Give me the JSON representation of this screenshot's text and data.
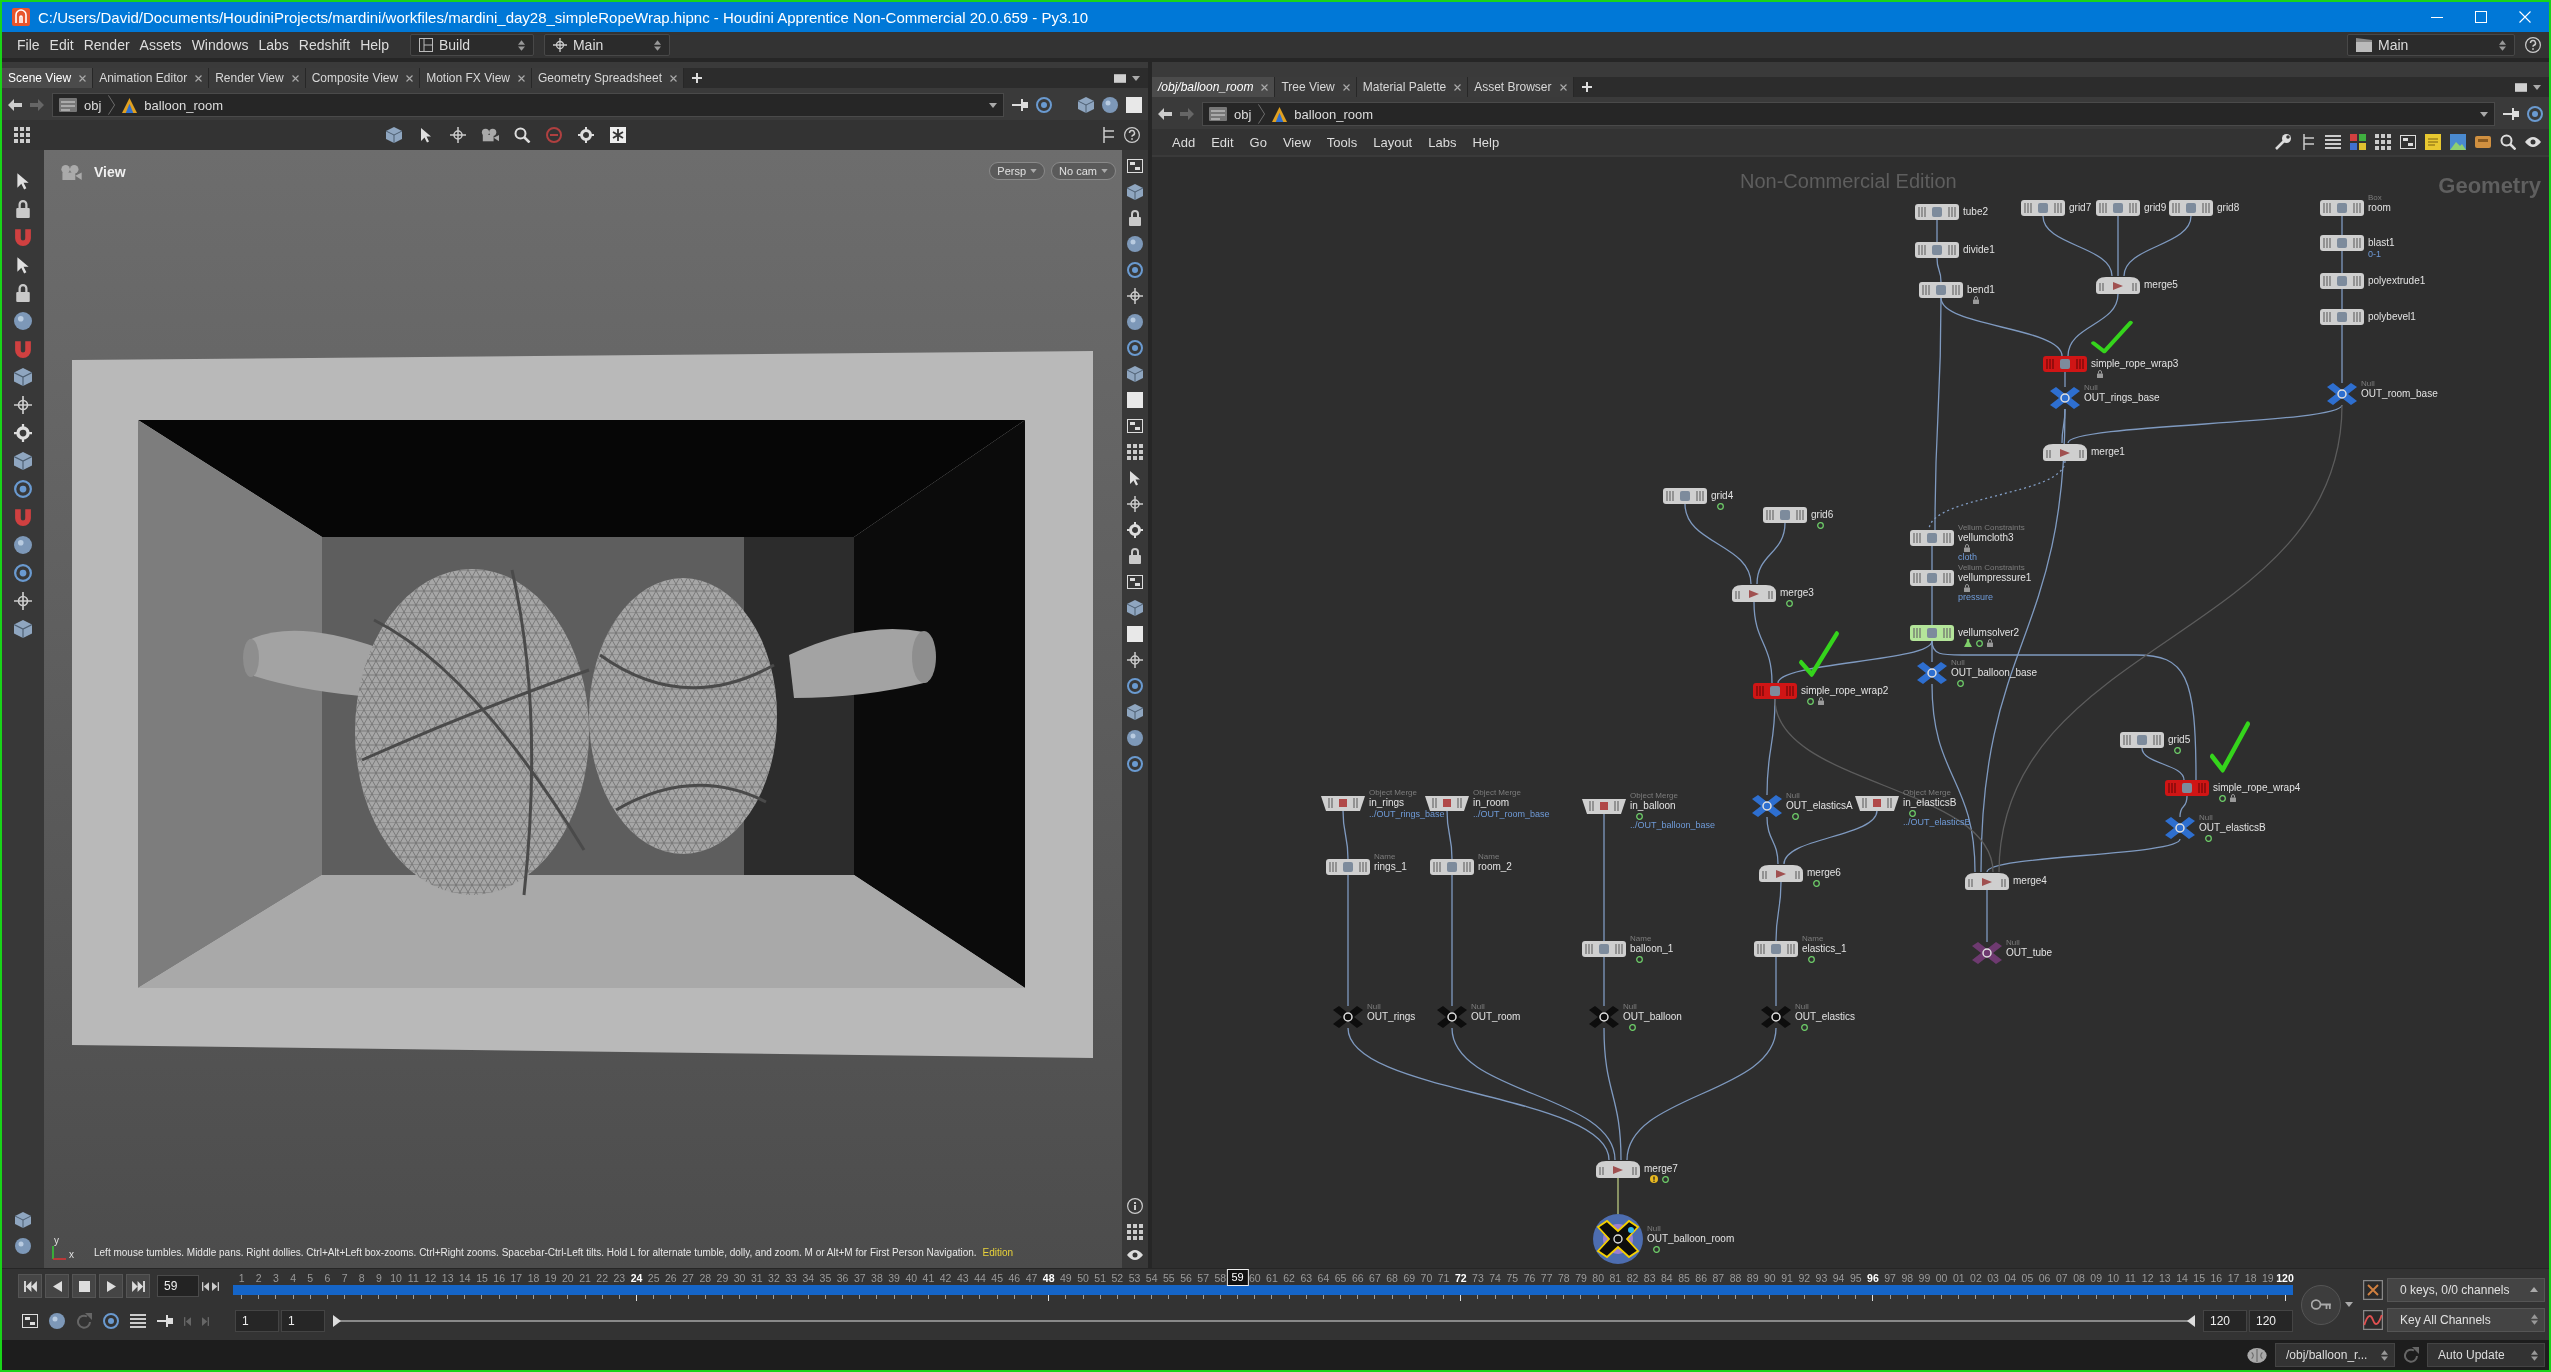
{
  "window": {
    "title": "C:/Users/David/Documents/HoudiniProjects/mardini/workfiles/mardini_day28_simpleRopeWrap.hipnc - Houdini Apprentice Non-Commercial 20.0.659 - Py3.10"
  },
  "menu": [
    "File",
    "Edit",
    "Render",
    "Assets",
    "Windows",
    "Labs",
    "Redshift",
    "Help"
  ],
  "shelf_set": "Build",
  "desktop": "Main",
  "right_desktop": "Main",
  "left_pane": {
    "tabs": [
      {
        "label": "Scene View",
        "selected": true
      },
      {
        "label": "Animation Editor",
        "selected": false
      },
      {
        "label": "Render View",
        "selected": false
      },
      {
        "label": "Composite View",
        "selected": false
      },
      {
        "label": "Motion FX View",
        "selected": false
      },
      {
        "label": "Geometry Spreadsheet",
        "selected": false
      }
    ],
    "path": [
      "obj",
      "balloon_room"
    ],
    "viewport": {
      "title": "View",
      "camera_buttons": [
        "Persp",
        "No cam"
      ],
      "axis_labels": [
        "y",
        "x"
      ],
      "hint": "Left mouse tumbles. Middle pans. Right dollies. Ctrl+Alt+Left box-zooms. Ctrl+Right zooms. Spacebar-Ctrl-Left tilts. Hold L for alternate tumble, dolly, and zoom. M or Alt+M for First Person Navigation.",
      "edition": "Edition"
    }
  },
  "right_pane": {
    "tabs": [
      {
        "label": "/obj/balloon_room",
        "selected": true
      },
      {
        "label": "Tree View",
        "selected": false
      },
      {
        "label": "Material Palette",
        "selected": false
      },
      {
        "label": "Asset Browser",
        "selected": false
      }
    ],
    "path": [
      "obj",
      "balloon_room"
    ],
    "menu": [
      "Add",
      "Edit",
      "Go",
      "View",
      "Tools",
      "Layout",
      "Labs",
      "Help"
    ],
    "watermark": "Non-Commercial Edition",
    "context": "Geometry",
    "nodes": [
      {
        "name": "tube2",
        "kind": "sop",
        "color": "#cfcfcf",
        "display": false
      },
      {
        "name": "grid7",
        "kind": "sop",
        "color": "#cfcfcf",
        "display": false
      },
      {
        "name": "grid9",
        "kind": "sop",
        "color": "#cfcfcf",
        "display": false
      },
      {
        "name": "grid8",
        "kind": "sop",
        "color": "#cfcfcf",
        "display": false
      },
      {
        "name": "room",
        "type": "Box",
        "kind": "sop",
        "color": "#cfcfcf",
        "display": false
      },
      {
        "name": "divide1",
        "kind": "sop",
        "color": "#cfcfcf",
        "display": false
      },
      {
        "name": "blast1",
        "parameter": "0-1",
        "kind": "sop",
        "color": "#cfcfcf",
        "display": false
      },
      {
        "name": "bend1",
        "badges": [
          {
            "kind": "lock"
          }
        ],
        "kind": "sop",
        "color": "#cfcfcf",
        "display": false
      },
      {
        "name": "merge5",
        "kind": "merge",
        "color": "#cfcfcf",
        "display": false
      },
      {
        "name": "polyextrude1",
        "kind": "sop",
        "color": "#cfcfcf",
        "display": false
      },
      {
        "name": "polybevel1",
        "kind": "sop",
        "color": "#cfcfcf",
        "display": false
      },
      {
        "name": "simple_rope_wrap3",
        "badges": [
          {
            "kind": "lock"
          }
        ],
        "kind": "sop",
        "color": "#d01515",
        "display": false
      },
      {
        "name": "OUT_rings_base",
        "type": "Null",
        "kind": "null",
        "color": "#2e6fd0",
        "display": false
      },
      {
        "name": "OUT_room_base",
        "type": "Null",
        "kind": "null",
        "color": "#2e6fd0",
        "display": false
      },
      {
        "name": "merge1",
        "kind": "merge",
        "color": "#cfcfcf",
        "display": false
      },
      {
        "name": "grid4",
        "badges": [
          {
            "kind": "dot"
          }
        ],
        "kind": "sop",
        "color": "#cfcfcf",
        "display": false
      },
      {
        "name": "grid6",
        "badges": [
          {
            "kind": "dot"
          }
        ],
        "kind": "sop",
        "color": "#cfcfcf",
        "display": false
      },
      {
        "name": "vellumcloth3",
        "type": "Vellum Constraints",
        "badges": [
          {
            "kind": "lock"
          }
        ],
        "parameter": "cloth",
        "kind": "sop",
        "color": "#cfcfcf",
        "display": false
      },
      {
        "name": "merge3",
        "badges": [
          {
            "kind": "dot"
          }
        ],
        "kind": "merge",
        "color": "#cfcfcf",
        "display": false
      },
      {
        "name": "vellumpressure1",
        "type": "Vellum Constraints",
        "badges": [
          {
            "kind": "lock"
          }
        ],
        "parameter": "pressure",
        "kind": "sop",
        "color": "#cfcfcf",
        "display": false
      },
      {
        "name": "vellumsolver2",
        "badges": [
          {
            "kind": "flask"
          },
          {
            "kind": "dot"
          },
          {
            "kind": "lock"
          }
        ],
        "kind": "sop",
        "color": "#b4e59a",
        "display": false
      },
      {
        "name": "OUT_balloon_base",
        "type": "Null",
        "badges": [
          {
            "kind": "dot"
          }
        ],
        "kind": "null",
        "color": "#2e6fd0",
        "display": false
      },
      {
        "name": "simple_rope_wrap2",
        "badges": [
          {
            "kind": "dot"
          },
          {
            "kind": "lock"
          }
        ],
        "kind": "sop",
        "color": "#d01515",
        "display": false
      },
      {
        "name": "grid5",
        "badges": [
          {
            "kind": "dot"
          }
        ],
        "kind": "sop",
        "color": "#cfcfcf",
        "display": false
      },
      {
        "name": "simple_rope_wrap4",
        "badges": [
          {
            "kind": "dot"
          },
          {
            "kind": "lock"
          }
        ],
        "kind": "sop",
        "color": "#d01515",
        "display": false
      },
      {
        "name": "in_rings",
        "type": "Object Merge",
        "parameter": "../OUT_rings_base",
        "kind": "objectmerge",
        "color": "#cfcfcf",
        "display": false
      },
      {
        "name": "in_room",
        "type": "Object Merge",
        "parameter": "../OUT_room_base",
        "kind": "objectmerge",
        "color": "#cfcfcf",
        "display": false
      },
      {
        "name": "in_balloon",
        "type": "Object Merge",
        "badges": [
          {
            "kind": "dot"
          }
        ],
        "parameter": "../OUT_balloon_base",
        "kind": "objectmerge",
        "color": "#cfcfcf",
        "display": false
      },
      {
        "name": "OUT_elasticsA",
        "type": "Null",
        "badges": [
          {
            "kind": "dot"
          }
        ],
        "kind": "null",
        "color": "#2e6fd0",
        "display": false
      },
      {
        "name": "in_elasticsB",
        "type": "Object Merge",
        "badges": [
          {
            "kind": "dot"
          }
        ],
        "parameter": "../OUT_elasticsB",
        "kind": "objectmerge",
        "color": "#cfcfcf",
        "display": false
      },
      {
        "name": "OUT_elasticsB",
        "type": "Null",
        "badges": [
          {
            "kind": "dot"
          }
        ],
        "kind": "null",
        "color": "#2e6fd0",
        "display": false
      },
      {
        "name": "rings_1",
        "type": "Name",
        "kind": "sop",
        "color": "#cfcfcf",
        "display": false
      },
      {
        "name": "room_2",
        "type": "Name",
        "kind": "sop",
        "color": "#cfcfcf",
        "display": false
      },
      {
        "name": "merge6",
        "badges": [
          {
            "kind": "dot"
          }
        ],
        "kind": "merge",
        "color": "#cfcfcf",
        "display": false
      },
      {
        "name": "merge4",
        "kind": "merge",
        "color": "#cfcfcf",
        "display": false
      },
      {
        "name": "balloon_1",
        "type": "Name",
        "badges": [
          {
            "kind": "dot"
          }
        ],
        "kind": "sop",
        "color": "#cfcfcf",
        "display": false
      },
      {
        "name": "elastics_1",
        "type": "Name",
        "badges": [
          {
            "kind": "dot"
          }
        ],
        "kind": "sop",
        "color": "#cfcfcf",
        "display": false
      },
      {
        "name": "OUT_tube",
        "type": "Null",
        "kind": "null",
        "color": "#6e3a70",
        "display": false
      },
      {
        "name": "OUT_rings",
        "type": "Null",
        "kind": "null",
        "color": "#0d0d0d",
        "display": false
      },
      {
        "name": "OUT_room",
        "type": "Null",
        "kind": "null",
        "color": "#0d0d0d",
        "display": false
      },
      {
        "name": "OUT_balloon",
        "type": "Null",
        "badges": [
          {
            "kind": "dot"
          }
        ],
        "kind": "null",
        "color": "#0d0d0d",
        "display": false
      },
      {
        "name": "OUT_elastics",
        "type": "Null",
        "badges": [
          {
            "kind": "dot"
          }
        ],
        "kind": "null",
        "color": "#0d0d0d",
        "display": false
      },
      {
        "name": "merge7",
        "badges": [
          {
            "kind": "warning"
          },
          {
            "kind": "dot"
          }
        ],
        "kind": "merge",
        "color": "#cfcfcf",
        "display": false
      },
      {
        "name": "OUT_balloon_room",
        "type": "Null",
        "badges": [
          {
            "kind": "dot"
          }
        ],
        "kind": "null",
        "color": "#0d0d0d",
        "display": true
      }
    ]
  },
  "timeline": {
    "frame": "59",
    "frames_before": [
      {
        "label": "1",
        "major": false
      },
      {
        "label": "2",
        "major": false
      },
      {
        "label": "3",
        "major": false
      },
      {
        "label": "4",
        "major": false
      },
      {
        "label": "5",
        "major": false
      },
      {
        "label": "6",
        "major": false
      },
      {
        "label": "7",
        "major": false
      },
      {
        "label": "8",
        "major": false
      },
      {
        "label": "9",
        "major": false
      },
      {
        "label": "10",
        "major": false
      },
      {
        "label": "11",
        "major": false
      },
      {
        "label": "12",
        "major": false
      },
      {
        "label": "13",
        "major": false
      },
      {
        "label": "14",
        "major": false
      },
      {
        "label": "15",
        "major": false
      },
      {
        "label": "16",
        "major": false
      },
      {
        "label": "17",
        "major": false
      },
      {
        "label": "18",
        "major": false
      },
      {
        "label": "19",
        "major": false
      },
      {
        "label": "20",
        "major": false
      },
      {
        "label": "21",
        "major": false
      },
      {
        "label": "22",
        "major": false
      },
      {
        "label": "23",
        "major": false
      },
      {
        "label": "24",
        "major": true
      },
      {
        "label": "25",
        "major": false
      },
      {
        "label": "26",
        "major": false
      },
      {
        "label": "27",
        "major": false
      },
      {
        "label": "28",
        "major": false
      },
      {
        "label": "29",
        "major": false
      },
      {
        "label": "30",
        "major": false
      },
      {
        "label": "31",
        "major": false
      },
      {
        "label": "32",
        "major": false
      },
      {
        "label": "33",
        "major": false
      },
      {
        "label": "34",
        "major": false
      },
      {
        "label": "35",
        "major": false
      },
      {
        "label": "36",
        "major": false
      },
      {
        "label": "37",
        "major": false
      },
      {
        "label": "38",
        "major": false
      },
      {
        "label": "39",
        "major": false
      },
      {
        "label": "40",
        "major": false
      },
      {
        "label": "41",
        "major": false
      },
      {
        "label": "42",
        "major": false
      },
      {
        "label": "43",
        "major": false
      },
      {
        "label": "44",
        "major": false
      },
      {
        "label": "45",
        "major": false
      },
      {
        "label": "46",
        "major": false
      },
      {
        "label": "47",
        "major": false
      },
      {
        "label": "48",
        "major": true
      },
      {
        "label": "49",
        "major": false
      },
      {
        "label": "50",
        "major": false
      },
      {
        "label": "51",
        "major": false
      },
      {
        "label": "52",
        "major": false
      },
      {
        "label": "53",
        "major": false
      },
      {
        "label": "54",
        "major": false
      },
      {
        "label": "55",
        "major": false
      },
      {
        "label": "56",
        "major": false
      },
      {
        "label": "57",
        "major": false
      },
      {
        "label": "58",
        "major": false
      }
    ],
    "current_frame": "59",
    "frames_after": [
      {
        "label": "60",
        "major": false
      },
      {
        "label": "61",
        "major": false
      },
      {
        "label": "62",
        "major": false
      },
      {
        "label": "63",
        "major": false
      },
      {
        "label": "64",
        "major": false
      },
      {
        "label": "65",
        "major": false
      },
      {
        "label": "66",
        "major": false
      },
      {
        "label": "67",
        "major": false
      },
      {
        "label": "68",
        "major": false
      },
      {
        "label": "69",
        "major": false
      },
      {
        "label": "70",
        "major": false
      },
      {
        "label": "71",
        "major": false
      },
      {
        "label": "72",
        "major": true
      },
      {
        "label": "73",
        "major": false
      },
      {
        "label": "74",
        "major": false
      },
      {
        "label": "75",
        "major": false
      },
      {
        "label": "76",
        "major": false
      },
      {
        "label": "77",
        "major": false
      },
      {
        "label": "78",
        "major": false
      },
      {
        "label": "79",
        "major": false
      },
      {
        "label": "80",
        "major": false
      },
      {
        "label": "81",
        "major": false
      },
      {
        "label": "82",
        "major": false
      },
      {
        "label": "83",
        "major": false
      },
      {
        "label": "84",
        "major": false
      },
      {
        "label": "85",
        "major": false
      },
      {
        "label": "86",
        "major": false
      },
      {
        "label": "87",
        "major": false
      },
      {
        "label": "88",
        "major": false
      },
      {
        "label": "89",
        "major": false
      },
      {
        "label": "90",
        "major": false
      },
      {
        "label": "91",
        "major": false
      },
      {
        "label": "92",
        "major": false
      },
      {
        "label": "93",
        "major": false
      },
      {
        "label": "94",
        "major": false
      },
      {
        "label": "95",
        "major": false
      },
      {
        "label": "96",
        "major": true
      },
      {
        "label": "97",
        "major": false
      },
      {
        "label": "98",
        "major": false
      },
      {
        "label": "99",
        "major": false
      },
      {
        "label": "00",
        "major": false
      },
      {
        "label": "01",
        "major": false
      },
      {
        "label": "02",
        "major": false
      },
      {
        "label": "03",
        "major": false
      },
      {
        "label": "04",
        "major": false
      },
      {
        "label": "05",
        "major": false
      },
      {
        "label": "06",
        "major": false
      },
      {
        "label": "07",
        "major": false
      },
      {
        "label": "08",
        "major": false
      },
      {
        "label": "09",
        "major": false
      },
      {
        "label": "10",
        "major": false
      },
      {
        "label": "11",
        "major": false
      },
      {
        "label": "12",
        "major": false
      },
      {
        "label": "13",
        "major": false
      },
      {
        "label": "14",
        "major": false
      },
      {
        "label": "15",
        "major": false
      },
      {
        "label": "16",
        "major": false
      },
      {
        "label": "17",
        "major": false
      },
      {
        "label": "18",
        "major": false
      },
      {
        "label": "19",
        "major": false
      },
      {
        "label": "120",
        "major": true
      }
    ],
    "range_start": [
      "1",
      "1"
    ],
    "range_end": [
      "120",
      "120"
    ],
    "keys": "0 keys, 0/0 channels",
    "key_mode": "Key All Channels"
  },
  "status_bar": {
    "path": "/obj/balloon_r...",
    "update_mode": "Auto Update"
  }
}
